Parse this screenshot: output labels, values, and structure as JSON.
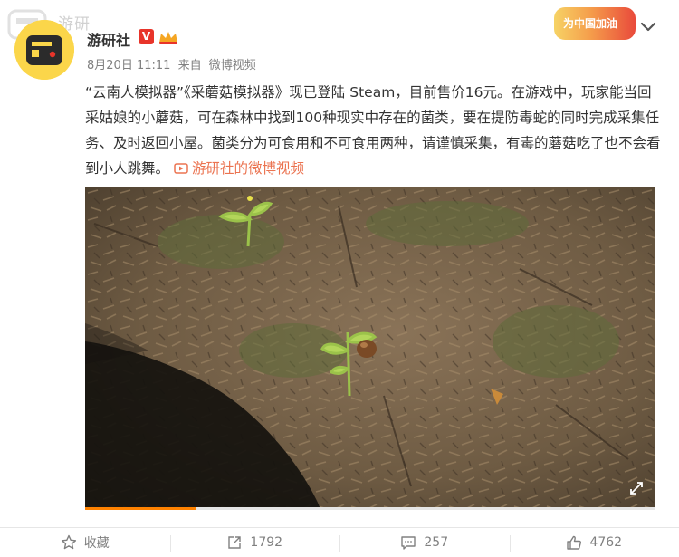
{
  "watermark": {
    "text": "游研"
  },
  "header": {
    "username": "游研社",
    "verified_badge": "V",
    "timestamp": "8月20日 11:11",
    "source_prefix": "来自",
    "source": "微博视频",
    "campaign_label": "为中国加油"
  },
  "post": {
    "text": "“云南人模拟器”《采蘑菇模拟器》现已登陆 Steam，目前售价16元。在游戏中，玩家能当回采姑娘的小蘑菇，可在森林中找到100种现实中存在的菌类，要在提防毒蛇的同时完成采集任务、及时返回小屋。菌类分为可食用和不可食用两种，请谨慎采集，有毒的蘑菇吃了也不会看到小人跳舞。",
    "video_link": "游研社的微博视频"
  },
  "video": {
    "progress": 0.195
  },
  "actions": {
    "favorite_label": "收藏",
    "repost_count": "1792",
    "comment_count": "257",
    "like_count": "4762"
  },
  "colors": {
    "accent_orange": "#eb7350",
    "progress": "#ff8200",
    "verified_red": "#e8342a",
    "avatar_yellow": "#fbd64a"
  },
  "icons": {
    "more": "chevron-down-icon",
    "favorite": "star-icon",
    "repost": "share-icon",
    "comment": "comment-icon",
    "like": "thumbs-up-icon",
    "fullscreen": "fullscreen-icon",
    "video_link": "play-icon"
  }
}
